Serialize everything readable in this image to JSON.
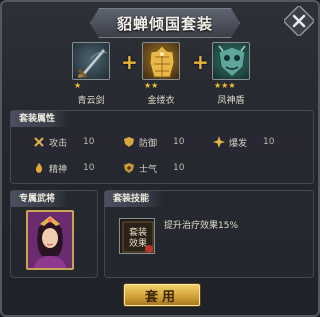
{
  "title": "貂蝉倾国套装",
  "items": [
    {
      "name": "青云剑",
      "stars": "★",
      "icon": "sword-icon"
    },
    {
      "name": "金缕衣",
      "stars": "★★",
      "icon": "golden-armor-icon"
    },
    {
      "name": "凤神盾",
      "stars": "★★★",
      "icon": "shield-icon"
    }
  ],
  "plus_symbol": "+",
  "attributes": {
    "header": "套装属性",
    "rows": [
      {
        "label": "攻击",
        "value": "10",
        "icon": "crossed-swords-icon"
      },
      {
        "label": "防御",
        "value": "10",
        "icon": "shield-icon"
      },
      {
        "label": "爆发",
        "value": "10",
        "icon": "burst-icon"
      },
      {
        "label": "精神",
        "value": "10",
        "icon": "flame-icon"
      },
      {
        "label": "士气",
        "value": "10",
        "icon": "morale-shield-icon"
      }
    ]
  },
  "general": {
    "header": "专属武将"
  },
  "skill": {
    "header": "套装技能",
    "icon_text": "套装效果",
    "description": "提升治疗效果15%"
  },
  "button": {
    "label": "套用"
  },
  "colors": {
    "accent_gold": "#d3a33a",
    "star": "#f2c230"
  }
}
